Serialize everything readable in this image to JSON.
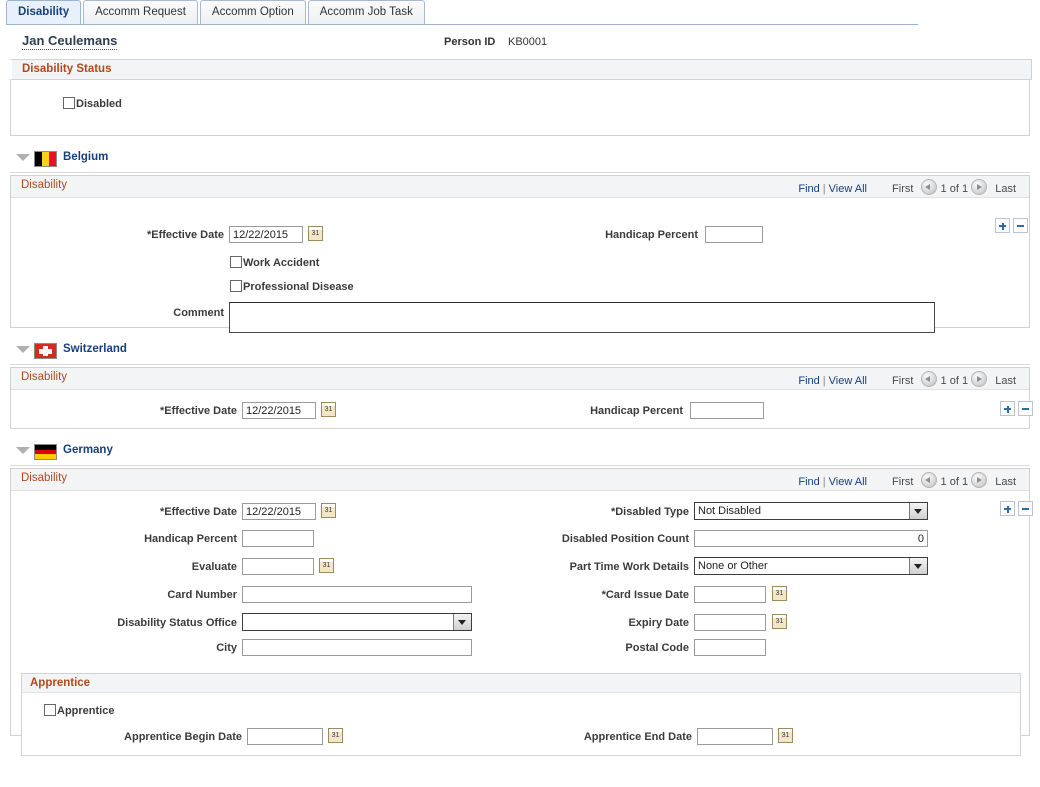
{
  "tabs": [
    {
      "label": "Disability",
      "active": true
    },
    {
      "label": "Accomm Request",
      "active": false
    },
    {
      "label": "Accomm Option",
      "active": false
    },
    {
      "label": "Accomm Job Task",
      "active": false
    }
  ],
  "person": {
    "name": "Jan Ceulemans",
    "id_label": "Person ID",
    "id_value": "KB0001"
  },
  "disability_status": {
    "title": "Disability Status",
    "disabled_checkbox_label": "Disabled",
    "disabled_checked": false
  },
  "grid_nav": {
    "find": "Find",
    "separator": "|",
    "view_all": "View All",
    "first": "First",
    "counter": "1 of 1",
    "last": "Last"
  },
  "calendar_icon_text": "31",
  "belgium": {
    "country": "Belgium",
    "flag": "flag-belgium-icon",
    "grid_title": "Disability",
    "effective_date_label": "*Effective Date",
    "effective_date_value": "12/22/2015",
    "handicap_percent_label": "Handicap Percent",
    "handicap_percent_value": "",
    "work_accident_label": "Work Accident",
    "work_accident_checked": false,
    "professional_disease_label": "Professional Disease",
    "professional_disease_checked": false,
    "comment_label": "Comment",
    "comment_value": ""
  },
  "switzerland": {
    "country": "Switzerland",
    "flag": "flag-switzerland-icon",
    "grid_title": "Disability",
    "effective_date_label": "*Effective Date",
    "effective_date_value": "12/22/2015",
    "handicap_percent_label": "Handicap Percent",
    "handicap_percent_value": ""
  },
  "germany": {
    "country": "Germany",
    "flag": "flag-germany-icon",
    "grid_title": "Disability",
    "effective_date_label": "*Effective Date",
    "effective_date_value": "12/22/2015",
    "handicap_percent_label": "Handicap Percent",
    "handicap_percent_value": "",
    "evaluate_label": "Evaluate",
    "evaluate_value": "",
    "card_number_label": "Card Number",
    "card_number_value": "",
    "disability_status_office_label": "Disability Status Office",
    "disability_status_office_value": "",
    "city_label": "City",
    "city_value": "",
    "disabled_type_label": "*Disabled Type",
    "disabled_type_value": "Not Disabled",
    "disabled_position_count_label": "Disabled Position Count",
    "disabled_position_count_value": "0",
    "part_time_work_details_label": "Part Time Work Details",
    "part_time_work_details_value": "None or Other",
    "card_issue_date_label": "*Card Issue Date",
    "card_issue_date_value": "",
    "expiry_date_label": "Expiry Date",
    "expiry_date_value": "",
    "postal_code_label": "Postal Code",
    "postal_code_value": "",
    "apprentice": {
      "title": "Apprentice",
      "checkbox_label": "Apprentice",
      "checked": false,
      "begin_date_label": "Apprentice Begin Date",
      "begin_date_value": "",
      "end_date_label": "Apprentice End Date",
      "end_date_value": ""
    }
  }
}
